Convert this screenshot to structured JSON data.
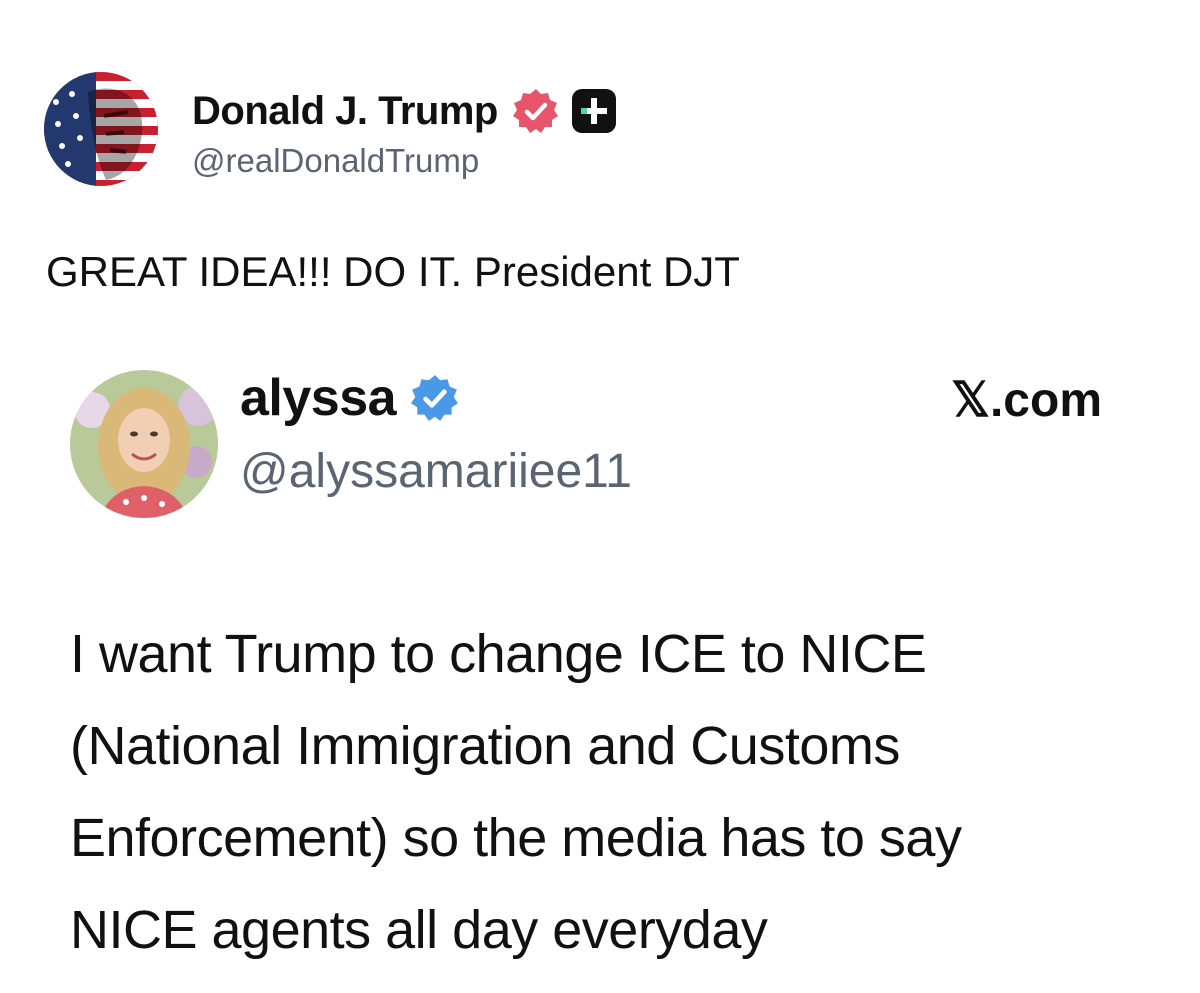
{
  "post": {
    "author_name": "Donald J. Trump",
    "author_handle": "@realDonaldTrump",
    "text": "GREAT IDEA!!! DO IT. President DJT",
    "badges": [
      "verified-badge-icon",
      "plus-badge-icon"
    ]
  },
  "embed": {
    "author_name": "alyssa",
    "author_handle": "@alyssamariiee11",
    "source_label": "𝕏.com",
    "body_lines": [
      "I want Trump to change ICE to NICE",
      "(National Immigration and Customs",
      "Enforcement) so the media has to say",
      "NICE agents all day everyday"
    ]
  },
  "colors": {
    "verified_pink": "#e8546b",
    "verified_blue": "#4a99e9",
    "handle_gray": "#5b6472",
    "text": "#111111",
    "plus_accent": "#4fd1b5"
  }
}
